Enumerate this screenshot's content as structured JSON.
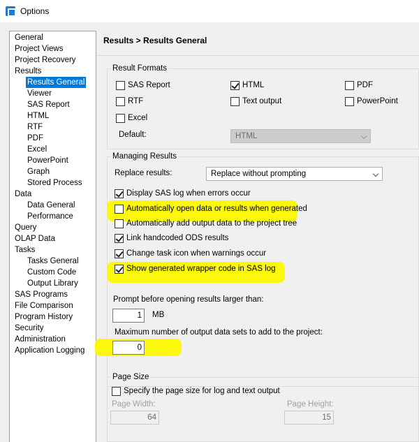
{
  "window": {
    "title": "Options"
  },
  "nav": {
    "items": [
      "General",
      "Project Views",
      "Project Recovery",
      "Results",
      "Results General",
      "Viewer",
      "SAS Report",
      "HTML",
      "RTF",
      "PDF",
      "Excel",
      "PowerPoint",
      "Graph",
      "Stored Process",
      "Data",
      "Data General",
      "Performance",
      "Query",
      "OLAP Data",
      "Tasks",
      "Tasks General",
      "Custom Code",
      "Output Library",
      "SAS Programs",
      "File Comparison",
      "Program History",
      "Security",
      "Administration",
      "Application Logging"
    ],
    "selected": "Results General"
  },
  "page": {
    "heading": "Results > Results General"
  },
  "result_formats": {
    "title": "Result Formats",
    "options": [
      {
        "label": "SAS Report",
        "checked": false
      },
      {
        "label": "HTML",
        "checked": true
      },
      {
        "label": "PDF",
        "checked": false
      },
      {
        "label": "RTF",
        "checked": false
      },
      {
        "label": "Text output",
        "checked": false
      },
      {
        "label": "PowerPoint",
        "checked": false
      },
      {
        "label": "Excel",
        "checked": false
      }
    ],
    "default_label": "Default:",
    "default_value": "HTML"
  },
  "managing_results": {
    "title": "Managing Results",
    "replace_label": "Replace results:",
    "replace_value": "Replace without prompting",
    "options": [
      {
        "label": "Display SAS log when errors occur",
        "checked": true
      },
      {
        "label": "Automatically open data or results when generated",
        "checked": false
      },
      {
        "label": "Automatically add output data to the project tree",
        "checked": false
      },
      {
        "label": "Link handcoded ODS results",
        "checked": true
      },
      {
        "label": "Change task icon when warnings occur",
        "checked": true
      },
      {
        "label": "Show generated wrapper code in SAS log",
        "checked": true
      }
    ],
    "prompt_label": "Prompt before opening results larger than:",
    "prompt_value": "1",
    "prompt_unit": "MB",
    "max_label": "Maximum number of output data sets to add to the project:",
    "max_value": "0"
  },
  "page_size": {
    "title": "Page Size",
    "option_label": "Specify the page size for log and text output",
    "option_checked": false,
    "width_label": "Page Width:",
    "width_value": "64",
    "height_label": "Page Height:",
    "height_value": "15"
  },
  "colors": {
    "selection": "#0078d7",
    "highlight": "#fbf700"
  }
}
